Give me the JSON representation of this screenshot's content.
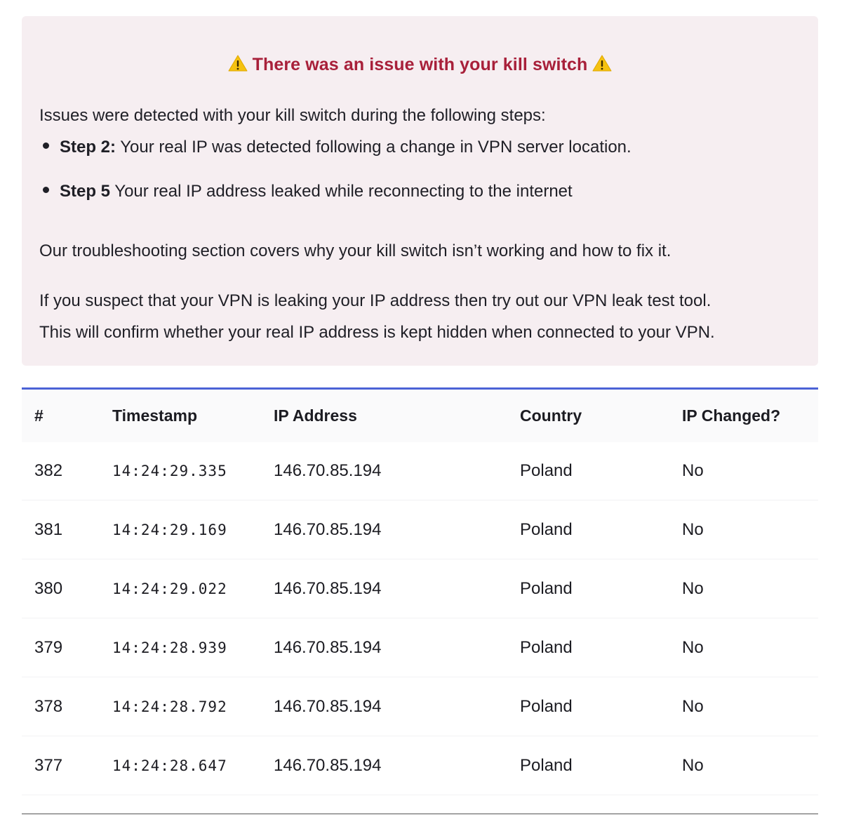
{
  "alert": {
    "title": "There was an issue with your kill switch",
    "title_icon": "warning-icon",
    "intro": "Issues were detected with your kill switch during the following steps:",
    "issues": [
      {
        "step": "Step 2:",
        "text": " Your real IP was detected following a change in VPN server location."
      },
      {
        "step": "Step 5",
        "text": " Your real IP address leaked while reconnecting to the internet"
      }
    ],
    "troubleshooting": "Our troubleshooting section covers why your kill switch isn’t working and how to fix it.",
    "leak_test_line1": "If you suspect that your VPN is leaking your IP address then try out our VPN leak test tool.",
    "leak_test_line2": "This will confirm whether your real IP address is kept hidden when connected to your VPN.",
    "colors": {
      "background": "#f6eef1",
      "title": "#a8203a",
      "warning": "#f5c211"
    }
  },
  "table": {
    "accent_color": "#4b62d6",
    "headers": [
      "#",
      "Timestamp",
      "IP Address",
      "Country",
      "IP Changed?"
    ],
    "rows": [
      {
        "num": "382",
        "timestamp": "14:24:29.335",
        "ip": "146.70.85.194",
        "country": "Poland",
        "changed": "No"
      },
      {
        "num": "381",
        "timestamp": "14:24:29.169",
        "ip": "146.70.85.194",
        "country": "Poland",
        "changed": "No"
      },
      {
        "num": "380",
        "timestamp": "14:24:29.022",
        "ip": "146.70.85.194",
        "country": "Poland",
        "changed": "No"
      },
      {
        "num": "379",
        "timestamp": "14:24:28.939",
        "ip": "146.70.85.194",
        "country": "Poland",
        "changed": "No"
      },
      {
        "num": "378",
        "timestamp": "14:24:28.792",
        "ip": "146.70.85.194",
        "country": "Poland",
        "changed": "No"
      },
      {
        "num": "377",
        "timestamp": "14:24:28.647",
        "ip": "146.70.85.194",
        "country": "Poland",
        "changed": "No"
      }
    ]
  }
}
